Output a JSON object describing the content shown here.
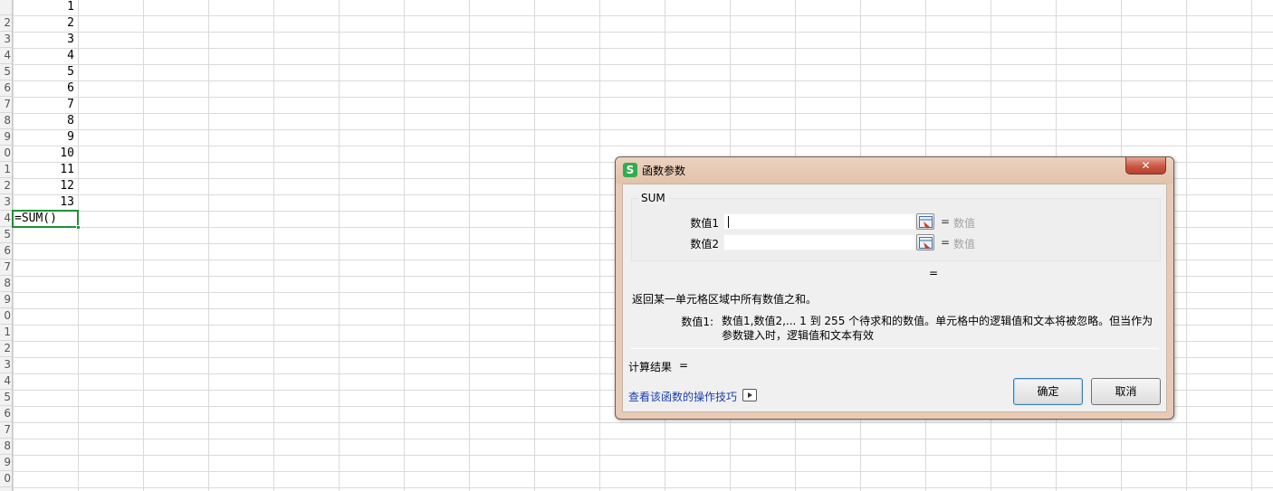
{
  "sheet": {
    "values": [
      "1",
      "2",
      "3",
      "4",
      "5",
      "6",
      "7",
      "8",
      "9",
      "10",
      "11",
      "12",
      "13"
    ],
    "row_header_digits": [
      "",
      "2",
      "3",
      "4",
      "5",
      "6",
      "7",
      "8",
      "9",
      "0",
      "1",
      "2",
      "3",
      "4",
      "5",
      "6",
      "7",
      "8",
      "9",
      "0",
      "1",
      "2",
      "3",
      "4",
      "5",
      "6",
      "7",
      "8",
      "9",
      "0"
    ],
    "active_cell_text": "=SUM()"
  },
  "dialog": {
    "title": "函数参数",
    "app_icon_letter": "S",
    "close_glyph": "✕",
    "function_name": "SUM",
    "args": [
      {
        "label": "数值1",
        "value": "",
        "equals": "=",
        "hint": "数值"
      },
      {
        "label": "数值2",
        "value": "",
        "equals": "=",
        "hint": "数值"
      }
    ],
    "result_equals": "=",
    "description": "返回某一单元格区域中所有数值之和。",
    "arg_help_label": "数值1:",
    "arg_help_text": "数值1,数值2,... 1 到 255 个待求和的数值。单元格中的逻辑值和文本将被忽略。但当作为参数键入时，逻辑值和文本有效",
    "calc_result_label": "计算结果",
    "calc_result_equals": "=",
    "help_link": "查看该函数的操作技巧",
    "ok_label": "确定",
    "cancel_label": "取消"
  },
  "colors": {
    "active_cell_border": "#1f8f3a",
    "dialog_frame": "#e8cbb6",
    "close_button": "#c95643",
    "link": "#1a3fb0"
  }
}
